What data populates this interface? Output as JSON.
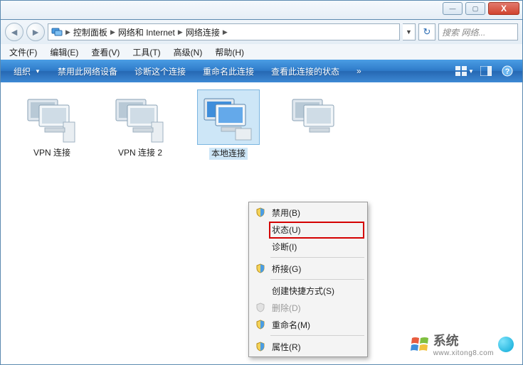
{
  "window_buttons": {
    "min": "—",
    "max": "▢",
    "close": "X"
  },
  "breadcrumb": {
    "root_icon": "network-icon",
    "segments": [
      "控制面板",
      "网络和 Internet",
      "网络连接"
    ]
  },
  "search": {
    "placeholder": "搜索 网络..."
  },
  "menubar": [
    "文件(F)",
    "编辑(E)",
    "查看(V)",
    "工具(T)",
    "高级(N)",
    "帮助(H)"
  ],
  "toolbar": {
    "organize": "组织",
    "disable": "禁用此网络设备",
    "diagnose": "诊断这个连接",
    "rename": "重命名此连接",
    "viewstatus": "查看此连接的状态"
  },
  "items": [
    {
      "label": "VPN 连接"
    },
    {
      "label": "VPN 连接 2"
    },
    {
      "label": "本地连接",
      "selected": true
    },
    {
      "label": ""
    }
  ],
  "context_menu": {
    "disable": "禁用(B)",
    "status": "状态(U)",
    "diagnose": "诊断(I)",
    "bridge": "桥接(G)",
    "shortcut": "创建快捷方式(S)",
    "delete": "删除(D)",
    "rename": "重命名(M)",
    "properties": "属性(R)"
  },
  "watermark": {
    "brand": "系统",
    "url": "www.xitong8.com"
  }
}
